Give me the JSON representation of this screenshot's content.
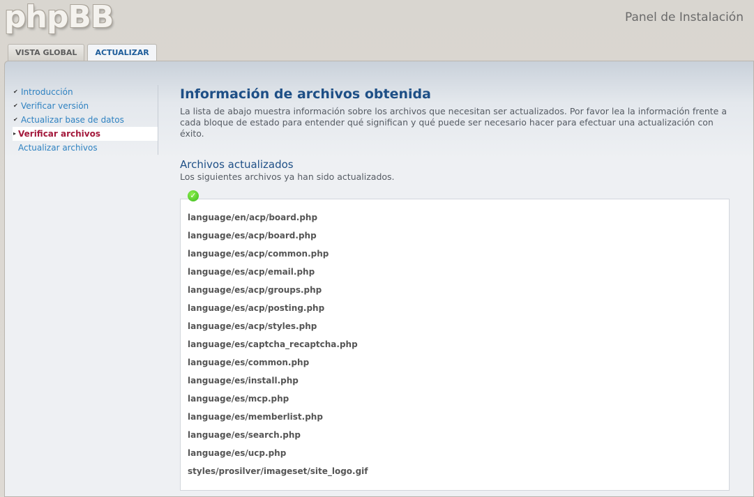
{
  "header": {
    "logo_text": "phpBB",
    "panel_title": "Panel de Instalación"
  },
  "tabs": [
    {
      "label": "VISTA GLOBAL",
      "active": false
    },
    {
      "label": "ACTUALIZAR",
      "active": true
    }
  ],
  "menu": {
    "items": [
      {
        "label": "Introducción",
        "state": "done"
      },
      {
        "label": "Verificar versión",
        "state": "done"
      },
      {
        "label": "Actualizar base de datos",
        "state": "done"
      },
      {
        "label": "Verificar archivos",
        "state": "current"
      },
      {
        "label": "Actualizar archivos",
        "state": "pending"
      }
    ]
  },
  "content": {
    "title": "Información de archivos obtenida",
    "description": "La lista de abajo muestra información sobre los archivos que necesitan ser actualizados. Por favor lea la información frente a cada bloque de estado para entender qué significan y qué puede ser necesario hacer para efectuar una actualización con éxito.",
    "section_title": "Archivos actualizados",
    "section_desc": "Los siguientes archivos ya han sido actualizados.",
    "status_icon": "check-circle-icon",
    "status_color": "#38b91c",
    "files": [
      "language/en/acp/board.php",
      "language/es/acp/board.php",
      "language/es/acp/common.php",
      "language/es/acp/email.php",
      "language/es/acp/groups.php",
      "language/es/acp/posting.php",
      "language/es/acp/styles.php",
      "language/es/captcha_recaptcha.php",
      "language/es/common.php",
      "language/es/install.php",
      "language/es/mcp.php",
      "language/es/memberlist.php",
      "language/es/search.php",
      "language/es/ucp.php",
      "styles/prosilver/imageset/site_logo.gif"
    ]
  }
}
